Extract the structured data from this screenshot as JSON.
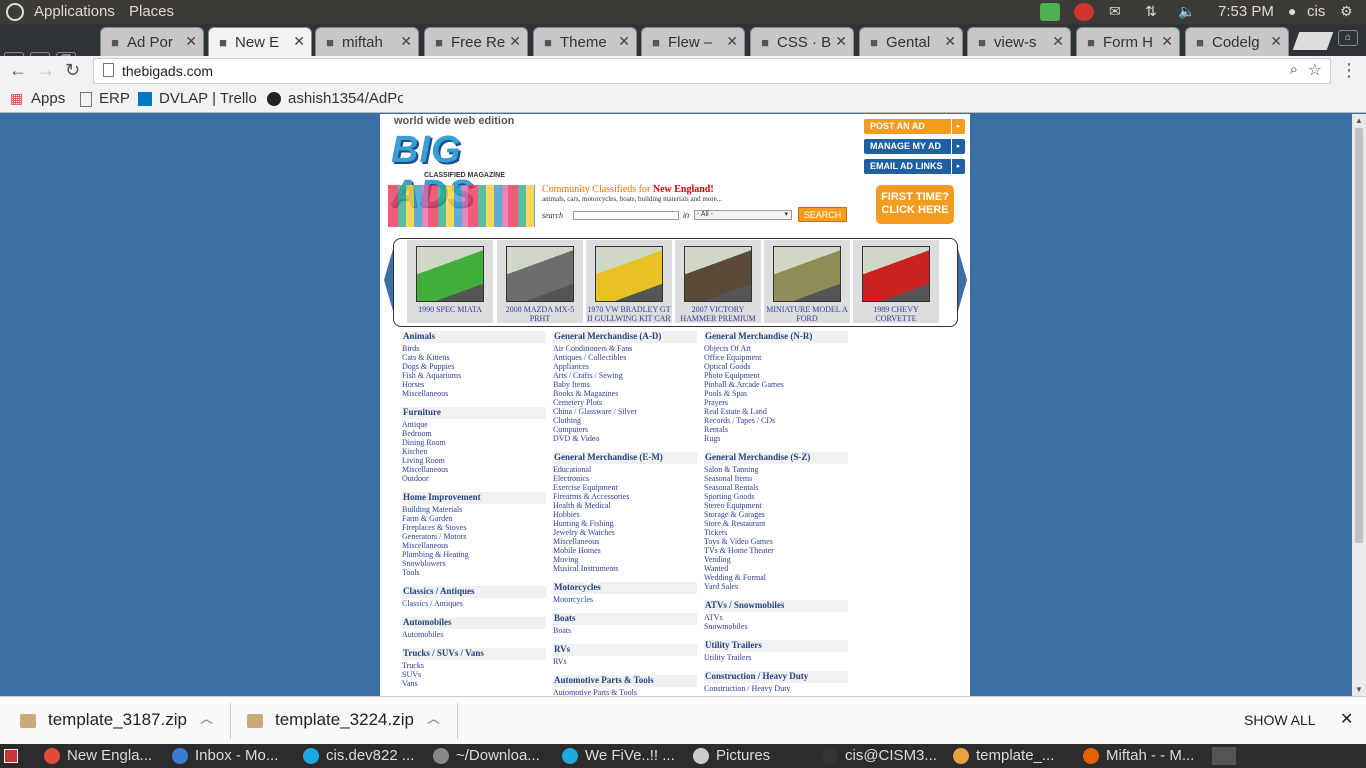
{
  "desktop": {
    "menu": [
      "Applications",
      "Places"
    ],
    "clock": "7:53 PM",
    "user": "cis"
  },
  "tabs": [
    {
      "label": "Ad Por",
      "icon": "page-icon"
    },
    {
      "label": "New E",
      "icon": "globe-icon",
      "active": true
    },
    {
      "label": "miftah",
      "icon": "j-icon"
    },
    {
      "label": "Free Re",
      "icon": "w3-icon"
    },
    {
      "label": "Theme",
      "icon": "page-icon"
    },
    {
      "label": "Flew –",
      "icon": "page-icon"
    },
    {
      "label": "CSS · B",
      "icon": "b-icon"
    },
    {
      "label": "Gental",
      "icon": "wordpress-icon"
    },
    {
      "label": "view-s",
      "icon": "wordpress-icon"
    },
    {
      "label": "Form H",
      "icon": "form-icon"
    },
    {
      "label": "Codelg",
      "icon": "fg-icon"
    }
  ],
  "address": {
    "url": "thebigads.com"
  },
  "bookmarks": [
    "Apps",
    "ERP",
    "DVLAP | Trello",
    "ashish1354/AdPo"
  ],
  "site": {
    "edition": "world wide web edition",
    "logo": "BIG ADS",
    "logo_sub": "CLASSIFIED MAGAZINE",
    "tagline_prefix": "Community Classifieds for ",
    "tagline_region": "New England!",
    "tagline_sub": "animals, cars, motorcycles, boats, building materials and more...",
    "search_label": "search",
    "in_label": "in",
    "category_select": "- All -",
    "search_button": "SEARCH",
    "buttons": {
      "post": "POST AN AD",
      "manage": "MANAGE MY AD",
      "email": "EMAIL AD LINKS",
      "first_time_1": "FIRST TIME?",
      "first_time_2": "CLICK HERE"
    },
    "featured": [
      {
        "caption": "1990 SPEC MIATA",
        "color": "#3fae3a"
      },
      {
        "caption": "2008 MAZDA MX-5 PRHT",
        "color": "#6d6d6d"
      },
      {
        "caption": "1970 VW BRADLEY GT II GULLWING KIT CAR",
        "color": "#e8c225"
      },
      {
        "caption": "2007 VICTORY HAMMER PREMIUM",
        "color": "#5a4a38"
      },
      {
        "caption": "MINIATURE MODEL A FORD",
        "color": "#8d8e55"
      },
      {
        "caption": "1989 CHEVY CORVETTE",
        "color": "#cc2121"
      }
    ],
    "columns": [
      [
        {
          "title": "Animals",
          "items": [
            "Birds",
            "Cats & Kittens",
            "Dogs & Puppies",
            "Fish & Aquariums",
            "Horses",
            "Miscellaneous"
          ]
        },
        {
          "title": "Furniture",
          "items": [
            "Antique",
            "Bedroom",
            "Dining Room",
            "Kitchen",
            "Living Room",
            "Miscellaneous",
            "Outdoor"
          ]
        },
        {
          "title": "Home Improvement",
          "items": [
            "Building Materials",
            "Farm & Garden",
            "Fireplaces & Stoves",
            "Generators / Motors",
            "Miscellaneous",
            "Plumbing & Heating",
            "Snowblowers",
            "Tools"
          ]
        },
        {
          "title": "Classics / Antiques",
          "items": [
            "Classics / Antiques"
          ]
        },
        {
          "title": "Automobiles",
          "items": [
            "Automobiles"
          ]
        },
        {
          "title": "Trucks / SUVs / Vans",
          "items": [
            "Trucks",
            "SUVs",
            "Vans"
          ]
        }
      ],
      [
        {
          "title": "General Merchandise (A-D)",
          "items": [
            "Air Conditioners & Fans",
            "Antiques / Collectibles",
            "Appliances",
            "Arts / Crafts / Sewing",
            "Baby Items",
            "Books & Magazines",
            "Cemetery Plots",
            "China / Glassware / Silver",
            "Clothing",
            "Computers",
            "DVD & Video"
          ]
        },
        {
          "title": "General Merchandise (E-M)",
          "items": [
            "Educational",
            "Electronics",
            "Exercise Equipment",
            "Firearms & Accessories",
            "Health & Medical",
            "Hobbies",
            "Hunting & Fishing",
            "Jewelry & Watches",
            "Miscellaneous",
            "Mobile Homes",
            "Moving",
            "Musical Instruments"
          ]
        },
        {
          "title": "Motorcycles",
          "items": [
            "Motorcycles"
          ]
        },
        {
          "title": "Boats",
          "items": [
            "Boats"
          ]
        },
        {
          "title": "RVs",
          "items": [
            "RVs"
          ]
        },
        {
          "title": "Automotive Parts & Tools",
          "items": [
            "Automotive Parts & Tools"
          ]
        }
      ],
      [
        {
          "title": "General Merchandise (N-R)",
          "items": [
            "Objects Of Art",
            "Office Equipment",
            "Optical Goods",
            "Photo Equipment",
            "Pinball & Arcade Games",
            "Pools & Spas",
            "Prayers",
            "Real Estate & Land",
            "Records / Tapes / CDs",
            "Rentals",
            "Rugs"
          ]
        },
        {
          "title": "General Merchandise (S-Z)",
          "items": [
            "Salon & Tanning",
            "Seasonal Items",
            "Seasonal Rentals",
            "Sporting Goods",
            "Stereo Equipment",
            "Storage & Garages",
            "Store & Restaurant",
            "Tickets",
            "Toys & Video Games",
            "TVs & Home Theater",
            "Vending",
            "Wanted",
            "Wedding & Formal",
            "Yard Sales"
          ]
        },
        {
          "title": "ATVs / Snowmobiles",
          "items": [
            "ATVs",
            "Snowmobiles"
          ]
        },
        {
          "title": "Utility Trailers",
          "items": [
            "Utility Trailers"
          ]
        },
        {
          "title": "Construction / Heavy Duty",
          "items": [
            "Construction / Heavy Duty"
          ]
        }
      ]
    ]
  },
  "downloads": {
    "files": [
      "template_3187.zip",
      "template_3224.zip"
    ],
    "show_all": "SHOW ALL"
  },
  "taskbar": [
    {
      "label": "New Engla...",
      "color": "#e04a3a"
    },
    {
      "label": "Inbox - Mo...",
      "color": "#3a7bd5"
    },
    {
      "label": "cis.dev822 ...",
      "color": "#1ea8e0"
    },
    {
      "label": "~/Downloa...",
      "color": "#888"
    },
    {
      "label": "We FiVe..!! ...",
      "color": "#1ea8e0"
    },
    {
      "label": "Pictures",
      "color": "#ccc"
    },
    {
      "label": "cis@CISM3...",
      "color": "#333"
    },
    {
      "label": "template_...",
      "color": "#e8a33c"
    },
    {
      "label": "Miftah - - M...",
      "color": "#e66000"
    }
  ]
}
